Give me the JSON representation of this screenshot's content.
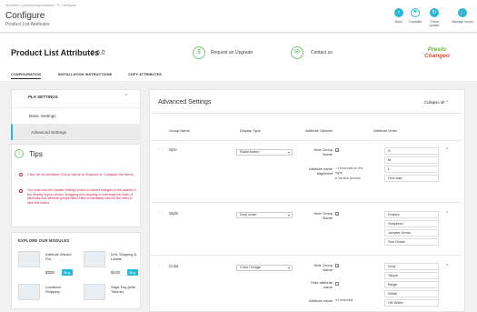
{
  "topbar": {
    "breadcrumb": "Modules / prestashopmodules / ✎ Configure",
    "title": "Configure",
    "subtitle": "Product List Attributes",
    "buttons": [
      {
        "label": "Back",
        "icon": "back-icon"
      },
      {
        "label": "Translate",
        "icon": "flag-icon"
      },
      {
        "label": "Check update",
        "icon": "refresh-icon"
      },
      {
        "label": "Manage hooks",
        "icon": "hooks-icon"
      }
    ]
  },
  "header": {
    "module_title": "Product List Attributes",
    "version": "2.0.0",
    "upgrade_label": "Request an Upgrade",
    "contact_label": "Contact us",
    "logo_line1": "Presto",
    "logo_line2": "Changeo"
  },
  "tabs": [
    {
      "label": "CONFIGURATION",
      "active": true
    },
    {
      "label": "INSTALLATION INSTRUCTIONS",
      "active": false
    },
    {
      "label": "COPY ATTRIBUTES",
      "active": false
    }
  ],
  "sidebar": {
    "heading": "PLA SETTINGS",
    "items": [
      {
        "label": "Basic Settings",
        "selected": false
      },
      {
        "label": "Advanced Settings",
        "selected": true
      }
    ]
  },
  "tips": {
    "title": "Tips",
    "items": [
      "Click on an Attribute Group name to Expand or Collapse the items",
      "You must click the Update Settings button to submit changes to the options in the Display Types column. Dragging and dropping to rearrange the order of attributes and attribute groups takes effect immediately without the need to click this button."
    ]
  },
  "modules": {
    "heading": "EXPLORE OUR MODULES",
    "items": [
      {
        "name": "Attribute Wizard Pro",
        "price": "$250",
        "buy": "Buy"
      },
      {
        "name": "DHL Shipping & Labels",
        "price": "$100",
        "buy": "Buy"
      },
      {
        "name": "Localized Shipping",
        "price": "",
        "buy": ""
      },
      {
        "name": "Sage Pay (with Tokens)",
        "price": "",
        "buy": ""
      }
    ]
  },
  "advanced": {
    "title": "Advanced Settings",
    "collapse_label": "Collapse all",
    "columns": [
      "Group Name",
      "Display Type",
      "Attribute Options",
      "Attribute Order"
    ],
    "option_labels": {
      "hide_group": "Hide Group Name",
      "alignment": "Attribute name alignment",
      "horizontal": "Horizontal (to the right)",
      "vertical": "Vertical (below)",
      "hide_attr": "Hide attribute name",
      "alignment_short": "Attribute name",
      "horizontal_short": "Horizontal"
    },
    "groups": [
      {
        "name": "Size",
        "display": "Radio button",
        "order": [
          "S",
          "M",
          "L",
          "One size"
        ]
      },
      {
        "name": "Style",
        "display": "Drop down",
        "order": [
          "Empire",
          "Strapless",
          "Jumper Dress",
          "Sun Dress"
        ]
      },
      {
        "name": "Color",
        "display": "Color / Image",
        "order": [
          "Grey",
          "Taupe",
          "Beige",
          "White",
          "Off White"
        ]
      }
    ]
  },
  "colors": {
    "accent": "#25b9d7",
    "green": "#5cb85c",
    "tip_red": "#c7254e"
  }
}
